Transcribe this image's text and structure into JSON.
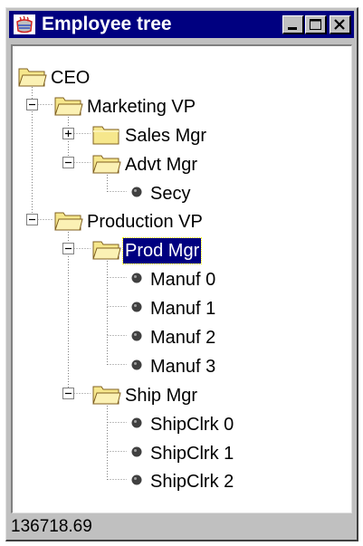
{
  "window": {
    "title": "Employee tree"
  },
  "colors": {
    "title_bar": "#000080",
    "selection": "#000080",
    "folder": "#f6e78c",
    "window_face": "#c0c0c0"
  },
  "tree": {
    "root": "CEO",
    "marketing_vp": "Marketing VP",
    "sales_mgr": "Sales Mgr",
    "advt_mgr": "Advt Mgr",
    "secy": "Secy",
    "production_vp": "Production VP",
    "prod_mgr": "Prod Mgr",
    "manuf_0": "Manuf 0",
    "manuf_1": "Manuf 1",
    "manuf_2": "Manuf 2",
    "manuf_3": "Manuf 3",
    "ship_mgr": "Ship Mgr",
    "shipclrk_0": "ShipClrk 0",
    "shipclrk_1": "ShipClrk 1",
    "shipclrk_2": "ShipClrk 2",
    "selected": "Prod Mgr"
  },
  "status_bar": {
    "value": "136718.69"
  }
}
